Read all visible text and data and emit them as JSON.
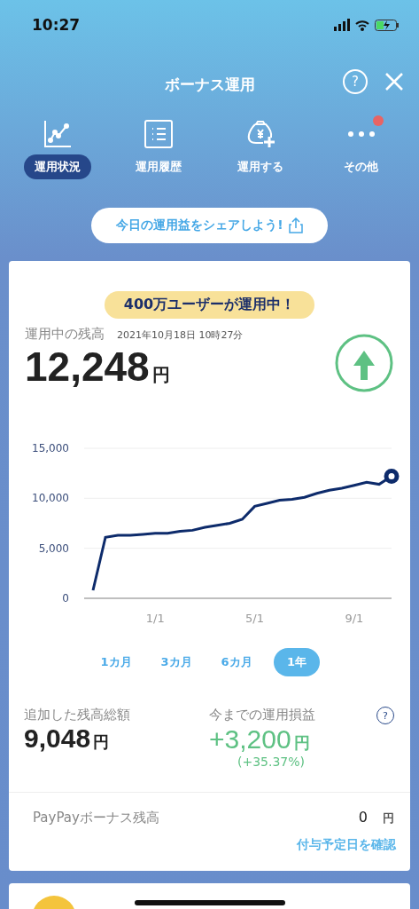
{
  "status_bar": {
    "time": "10:27"
  },
  "header": {
    "title": "ボーナス運用",
    "help": "?"
  },
  "tabs": [
    {
      "label": "運用状況",
      "selected": true,
      "kind": "chart",
      "notification": false
    },
    {
      "label": "運用履歴",
      "selected": false,
      "kind": "list",
      "notification": false
    },
    {
      "label": "運用する",
      "selected": false,
      "kind": "bag",
      "notification": false
    },
    {
      "label": "その他",
      "selected": false,
      "kind": "more",
      "notification": true
    }
  ],
  "share_button": {
    "label": "今日の運用益をシェアしよう!"
  },
  "balance_card": {
    "banner": "400万ユーザーが運用中！",
    "label": "運用中の残高",
    "timestamp": "2021年10月18日 10時27分",
    "amount": "12,248",
    "unit": "円",
    "chart_data": {
      "type": "line",
      "categories": [
        null,
        null,
        null,
        null,
        null,
        "1/1",
        null,
        null,
        null,
        null,
        null,
        null,
        null,
        "5/1",
        null,
        null,
        null,
        null,
        null,
        null,
        null,
        "9/1",
        null,
        null,
        null
      ],
      "series": [
        {
          "color": "#0d2b6b",
          "values": [
            800,
            6100,
            6300,
            6300,
            6400,
            6500,
            6500,
            6700,
            6800,
            7100,
            7300,
            7500,
            7900,
            9200,
            9500,
            9800,
            9900,
            10100,
            10500,
            10800,
            11000,
            11300,
            11600,
            11400,
            12200
          ]
        }
      ],
      "ylim": [
        0,
        15000
      ],
      "yticks": [
        {
          "value": 0,
          "label": "0"
        },
        {
          "value": 5000,
          "label": "5,000"
        },
        {
          "value": 10000,
          "label": "10,000"
        },
        {
          "value": 15000,
          "label": "15,000"
        }
      ]
    },
    "periods": [
      {
        "label": "1カ月",
        "selected": false
      },
      {
        "label": "3カ月",
        "selected": false
      },
      {
        "label": "6カ月",
        "selected": false
      },
      {
        "label": "1年",
        "selected": true
      }
    ],
    "added_label": "追加した残高総額",
    "added_amount": "9,048",
    "added_unit": "円",
    "profit_label": "今までの運用損益",
    "profit_help": "?",
    "profit_amount": "+3,200",
    "profit_unit": "円",
    "profit_percent": "(+35.37%)",
    "bonus_label": "PayPayボーナス残高",
    "bonus_amount": "0",
    "bonus_unit": "円",
    "bonus_link": "付与予定日を確認"
  }
}
